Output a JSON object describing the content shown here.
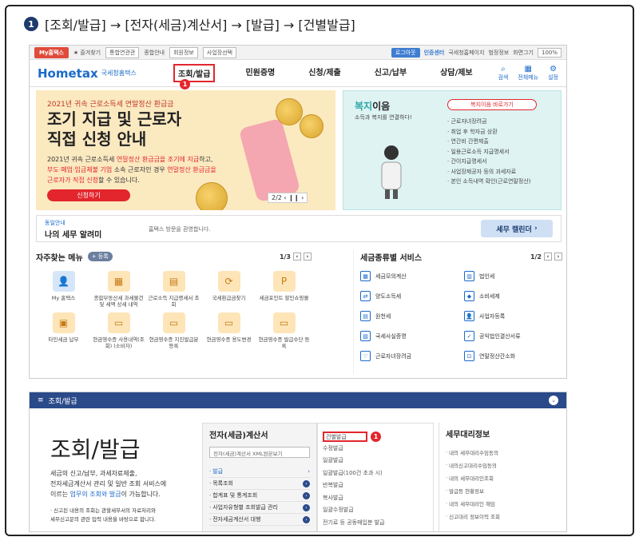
{
  "step": {
    "number": "1",
    "title": "[조회/발급] → [전자(세금)계산서] → [발급] → [건별발급]"
  },
  "topbar": {
    "my_tab": "My홈택스",
    "items": [
      "★ 즐겨찾기",
      "통합연관관",
      "종합안내",
      "회원정보",
      "사업장선택"
    ],
    "login": "로그아웃",
    "cert": "인증센터",
    "right_items": [
      "국세청홈페이지",
      "범정정보",
      "화면그기"
    ],
    "zoom": "100%"
  },
  "header": {
    "logo": "Hometax",
    "logo_sub": "국세청홈택스",
    "nav": [
      "조회/발급",
      "민원증명",
      "신청/제출",
      "신고/납부",
      "상담/제보"
    ],
    "highlight_badge": "1",
    "icons": [
      "검색",
      "전체메뉴",
      "설정"
    ]
  },
  "banner": {
    "subtitle": "2021년 귀속 근로소득세 연말정산 환급금",
    "title_line1": "조기 지급 및 근로자",
    "title_line2": "직접 신청 안내",
    "desc_line1_a": "2021년 귀속 근로소득세 ",
    "desc_line1_b": "연말정산 환급금을 조기에 지급",
    "desc_line1_c": "하고,",
    "desc_line2_a": "부도·폐업·임금체불 기업",
    "desc_line2_b": " 소속 근로자인 경우 ",
    "desc_line2_c": "연말정산 환급금을",
    "desc_line3_a": "근로자가 직접 신청",
    "desc_line3_b": "할 수 있습니다.",
    "button": "신청하기",
    "pager": "2/2"
  },
  "side_banner": {
    "title_a": "복지",
    "title_b": "이음",
    "subtitle": "소득과 복지를 연결하다!",
    "link": "복지이음 바로가기",
    "items": [
      "근로자녀장려금",
      "취업 후 학자금 상환",
      "연간비 간편제출",
      "일용근로소득 지급명세서",
      "간이지급명세서",
      "사업장제공자 등의 과세자료",
      "본인 소득내역 확인(근로연말정산)"
    ]
  },
  "notice": {
    "label": "동일안내",
    "title": "나의 세무 알려미",
    "text": "홈택스 방문을 환영합니다.",
    "button": "세무 캘린더"
  },
  "favorites": {
    "title": "자주찾는 메뉴",
    "register": "+ 등록",
    "page": "1/3",
    "items": [
      {
        "label": "My 홈택스",
        "icon": "person-icon",
        "glyph": "👤"
      },
      {
        "label": "종합부동산세 과세물건 및 세액 상세 내역",
        "icon": "calendar-icon",
        "glyph": "▦"
      },
      {
        "label": "근로소득 지급명세서 조회",
        "icon": "document-icon",
        "glyph": "▤"
      },
      {
        "label": "국세환급금찾기",
        "icon": "refund-icon",
        "glyph": "⟳"
      },
      {
        "label": "세금포인트 할인쇼핑몰",
        "icon": "point-icon",
        "glyph": "P"
      },
      {
        "label": "타인세금 납부",
        "icon": "tax-icon",
        "glyph": "▣"
      },
      {
        "label": "현금영수증 사용내역(조회) (소비자)",
        "icon": "receipt-icon",
        "glyph": "▭"
      },
      {
        "label": "현금영수증 지진발급분 등록",
        "icon": "receipt-icon",
        "glyph": "▭"
      },
      {
        "label": "현금영수증 용도변경",
        "icon": "receipt-icon",
        "glyph": "▭"
      },
      {
        "label": "현금영수증 발급수단 등록",
        "icon": "receipt-icon",
        "glyph": "▭"
      }
    ]
  },
  "services": {
    "title": "세금종류별 서비스",
    "page": "1/2",
    "items": [
      {
        "label": "세금모의계산",
        "icon": "calculator-icon",
        "glyph": "▦"
      },
      {
        "label": "법인세",
        "icon": "building-icon",
        "glyph": "▥"
      },
      {
        "label": "양도소득세",
        "icon": "transfer-icon",
        "glyph": "⇄"
      },
      {
        "label": "소비세제",
        "icon": "diamond-icon",
        "glyph": "◆"
      },
      {
        "label": "원천세",
        "icon": "document-icon",
        "glyph": "▤"
      },
      {
        "label": "사업자등록",
        "icon": "person-icon",
        "glyph": "👤"
      },
      {
        "label": "국세사실증명",
        "icon": "certificate-icon",
        "glyph": "▧"
      },
      {
        "label": "공익법인결산서류",
        "icon": "check-icon",
        "glyph": "✓"
      },
      {
        "label": "근로자녀장려금",
        "icon": "heart-icon",
        "glyph": "♡"
      },
      {
        "label": "연말정산간소화",
        "icon": "car-icon",
        "glyph": "⊡"
      }
    ]
  },
  "menu": {
    "bar_title": "조회/발급",
    "big_title": "조회/발급",
    "desc_a": "세금의 신고/납부, 과세자료제출,",
    "desc_b": "전자세금계산서 관리 및 일반 조회 서비스에",
    "desc_c_a": "이르는 ",
    "desc_c_b": "업무의 조회와 발급",
    "desc_c_c": "이 가능합니다.",
    "note_a": "· 신고된 내용의 조회는 관할세무서의 자료처리와",
    "note_b": "세무신고문의 관련 입력 내용을 바탕으로 합니다.",
    "col1_title": "전자(세금)계산서",
    "col1_input": "전자(세금)계산서 XML원본보기",
    "col1_items": [
      "발급",
      "목록조회",
      "합계표 및 통계조회",
      "사업자유형별 조회발급 관리",
      "전자세금계산서 대행"
    ],
    "col2_items": [
      "건별발급",
      "수정발급",
      "일괄발급",
      "일괄발급(100건 초과 시)",
      "반복발급",
      "복사발급",
      "일괄수정발급",
      "전기료 등 공동매입분 발급"
    ],
    "col2_badge": "1",
    "col3_title": "세무대리정보",
    "col3_items": [
      "내의 세무대리수임동의",
      "내의신고대리수임동의",
      "내의 세무대리인조회",
      "발급등 현황정보",
      "내의 세무대리인 해임",
      "신고대리 정보이력 조회"
    ]
  }
}
